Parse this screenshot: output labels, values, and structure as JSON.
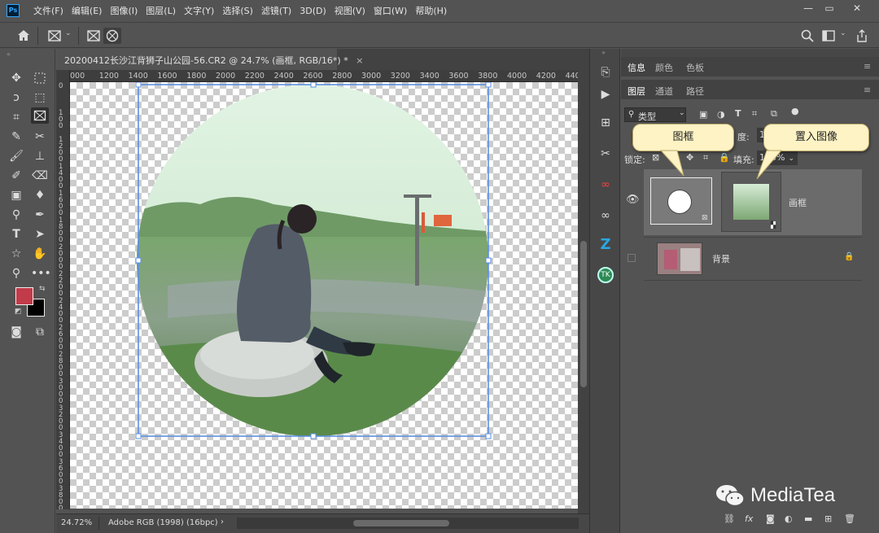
{
  "app": {
    "logo": "Ps"
  },
  "menu": [
    "文件(F)",
    "编辑(E)",
    "图像(I)",
    "图层(L)",
    "文字(Y)",
    "选择(S)",
    "滤镜(T)",
    "3D(D)",
    "视图(V)",
    "窗口(W)",
    "帮助(H)"
  ],
  "window_controls": {
    "minimize": "—",
    "restore": "▭",
    "close": "✕"
  },
  "document": {
    "tab_title": "20200412长沙江背狮子山公园-56.CR2 @ 24.7% (画框, RGB/16*) *",
    "tab_close": "×"
  },
  "ruler": {
    "h_ticks": [
      "000",
      "1200",
      "1400",
      "1600",
      "1800",
      "2000",
      "2200",
      "2400",
      "2600",
      "2800",
      "3000",
      "3200",
      "3400",
      "3600",
      "3800",
      "4000",
      "4200",
      "4400"
    ],
    "v_ticks": [
      "0",
      "1 0 0",
      "1 2 0 0",
      "1 4 0 0",
      "1 6 0 0",
      "1 8 0 0",
      "2 0 0 0",
      "2 2 0 0",
      "2 4 0 0",
      "2 6 0 0",
      "2 8 0 0",
      "3 0 0 0",
      "3 2 0 0",
      "3 4 0 0",
      "3 6 0 0",
      "3 8 0 0"
    ]
  },
  "status": {
    "zoom": "24.72%",
    "profile": "Adobe RGB (1998) (16bpc)",
    "arrow": "›"
  },
  "panels": {
    "top_tabs": [
      "信息",
      "颜色",
      "色板"
    ],
    "layer_tabs": [
      "图层",
      "通道",
      "路径"
    ],
    "filter_kind": "类型",
    "opacity_label": "度:",
    "opacity_value": "1",
    "lock_label": "锁定:",
    "fill_label": "填充:",
    "fill_value": "100%"
  },
  "layers": [
    {
      "name": "画框",
      "visible": true,
      "selected": true
    },
    {
      "name": "背景",
      "visible": false,
      "selected": false,
      "locked": true
    }
  ],
  "callouts": {
    "frame": "图框",
    "placed_image": "置入图像"
  },
  "watermark": {
    "text": "MediaTea"
  },
  "colors": {
    "foreground": "#c23b4a",
    "background": "#000000",
    "selection": "#5b8fdf",
    "selected_layer": "#6b6b6b"
  }
}
